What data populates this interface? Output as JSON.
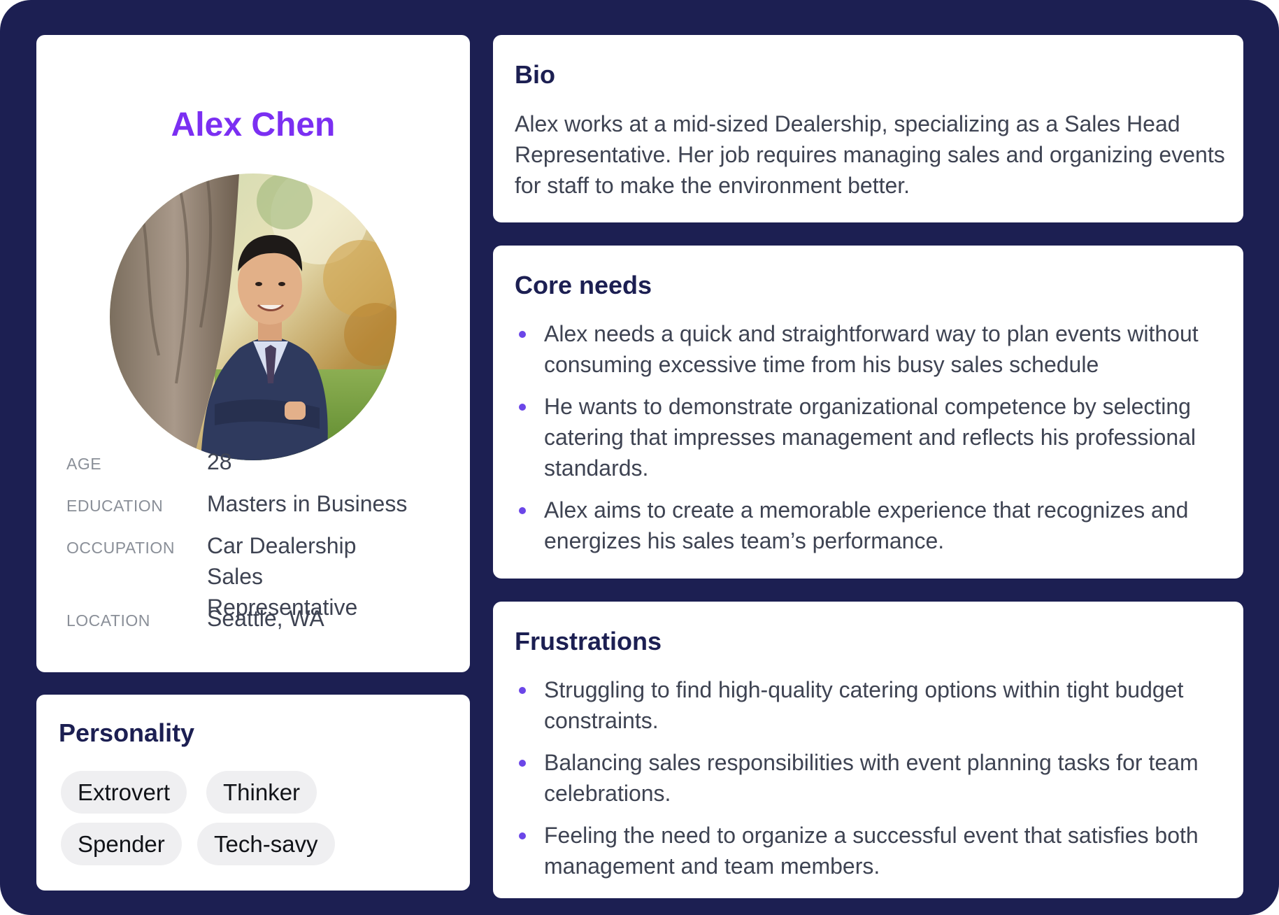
{
  "profile": {
    "name": "Alex Chen",
    "photo_icon": "person-portrait-photo",
    "facts": [
      {
        "label": "AGE",
        "value": "28"
      },
      {
        "label": "EDUCATION",
        "value": "Masters in Business"
      },
      {
        "label": "OCCUPATION",
        "value": "Car Dealership Sales Representative"
      },
      {
        "label": "LOCATION",
        "value": "Seattle, WA"
      }
    ]
  },
  "personality": {
    "title": "Personality",
    "tags": [
      "Extrovert",
      "Thinker",
      "Spender",
      "Tech-savy"
    ]
  },
  "bio": {
    "title": "Bio",
    "text": "Alex works at a mid-sized Dealership, specializing as a Sales Head Representative. Her job requires managing sales and organizing events for staff to make the environment better."
  },
  "core_needs": {
    "title": "Core needs",
    "items": [
      " Alex needs a quick and straightforward way to plan events without consuming excessive time from his busy sales schedule",
      "He wants to demonstrate organizational competence by selecting catering that impresses management and reflects his professional standards.",
      "Alex aims to create a memorable experience that recognizes and energizes his sales team’s performance."
    ]
  },
  "frustrations": {
    "title": "Frustrations",
    "items": [
      "Struggling to find high-quality catering options within tight budget constraints.",
      "Balancing sales responsibilities with event planning tasks for team celebrations.",
      "Feeling the need to organize a successful event that satisfies both management and team members."
    ]
  },
  "colors": {
    "background": "#1c1f52",
    "accent": "#7b2ff2",
    "bullet": "#6b46e8",
    "heading": "#1c1f52",
    "body_text": "#3e4352",
    "label_text": "#8a8f98",
    "tag_bg": "#efeff1"
  }
}
